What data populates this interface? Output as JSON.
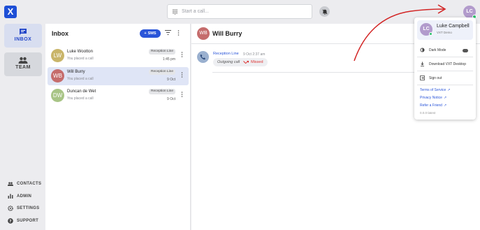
{
  "app": {
    "logo_text": "X"
  },
  "nav": {
    "inbox_label": "INBOX",
    "team_label": "TEAM",
    "footer": [
      {
        "label": "CONTACTS",
        "icon": "contacts-icon"
      },
      {
        "label": "ADMIN",
        "icon": "chart-icon"
      },
      {
        "label": "SETTINGS",
        "icon": "gear-icon"
      },
      {
        "label": "SUPPORT",
        "icon": "help-icon"
      }
    ]
  },
  "search": {
    "placeholder": "Start a call..."
  },
  "user": {
    "initials": "LC"
  },
  "inbox": {
    "title": "Inbox",
    "sms_label": "SMS",
    "conversations": [
      {
        "initials": "LW",
        "name": "Luke Wootton",
        "preview": "You placed a call",
        "badge": "Reception Line",
        "time": "1:45 pm",
        "color": "#c9b56a"
      },
      {
        "initials": "WB",
        "name": "Will Burry",
        "preview": "You placed a call",
        "badge": "Reception Line",
        "time": "9 Oct",
        "color": "#c56c6c"
      },
      {
        "initials": "DW",
        "name": "Duncan de Wet",
        "preview": "You placed a call",
        "badge": "Reception Line",
        "time": "9 Oct",
        "color": "#a8c486"
      }
    ]
  },
  "detail": {
    "initials": "WB",
    "name": "Will Burry",
    "call": {
      "line": "Reception Line",
      "time": "9 Oct 2:37 am",
      "direction": "Outgoing call",
      "status": "Missed"
    }
  },
  "menu": {
    "initials": "LC",
    "name": "Luke Campbell",
    "org": "VXT Demo",
    "dark_mode": "Dark Mode",
    "download": "Download VXT Desktop",
    "sign_out": "Sign out",
    "terms": "Terms of Service",
    "privacy": "Privacy Notice",
    "refer": "Refer a Friend",
    "version": "0.0.0-latest"
  },
  "colors": {
    "accent": "#2a55d9",
    "missed": "#dd3333",
    "online": "#2bbf6a",
    "annotation": "#d22222"
  }
}
